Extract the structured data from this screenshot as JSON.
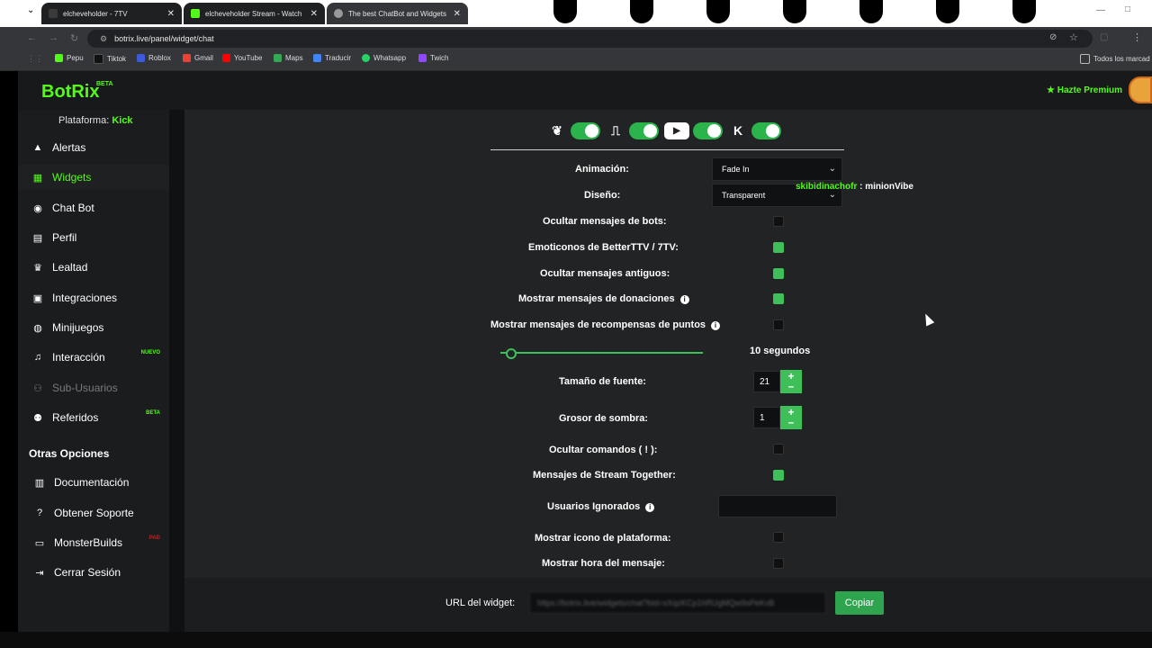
{
  "browser": {
    "tabs": [
      {
        "title": "elcheveholder - 7TV",
        "favicon_color": "#3a3a3a"
      },
      {
        "title": "elcheveholder Stream - Watch ",
        "favicon_color": "#53fc18"
      },
      {
        "title": "The best ChatBot and Widgets",
        "favicon_color": "#9a9a9a"
      }
    ],
    "url": "botrix.live/panel/widget/chat",
    "bookmarks": [
      {
        "label": "Pepu",
        "color": "#53fc18"
      },
      {
        "label": "Tiktok",
        "color": "#111111"
      },
      {
        "label": "Roblox",
        "color": "#3b5bdb"
      },
      {
        "label": "Gmail",
        "color": "#ea4335"
      },
      {
        "label": "YouTube",
        "color": "#ff0000"
      },
      {
        "label": "Maps",
        "color": "#34a853"
      },
      {
        "label": "Traducir",
        "color": "#4285f4"
      },
      {
        "label": "Whatsapp",
        "color": "#25d366"
      },
      {
        "label": "Twich",
        "color": "#9146ff"
      }
    ],
    "all_bookmarks": "Todos los marcad"
  },
  "header": {
    "logo": "BotRix",
    "beta": "BETA",
    "premium": "Hazte Premium"
  },
  "sidebar": {
    "platform_label": "Plataforma:",
    "platform_value": "Kick",
    "items": [
      {
        "label": "Alertas",
        "icon": "warning-icon"
      },
      {
        "label": "Widgets",
        "icon": "grid-icon"
      },
      {
        "label": "Chat Bot",
        "icon": "robot-icon"
      },
      {
        "label": "Perfil",
        "icon": "id-card-icon"
      },
      {
        "label": "Lealtad",
        "icon": "trophy-icon"
      },
      {
        "label": "Integraciones",
        "icon": "integrations-icon"
      },
      {
        "label": "Minijuegos",
        "icon": "gamepad-icon"
      },
      {
        "label": "Interacción",
        "icon": "music-icon",
        "tag": "NUEVO"
      },
      {
        "label": "Sub-Usuarios",
        "icon": "users-cog-icon"
      },
      {
        "label": "Referidos",
        "icon": "users-icon",
        "tag": "BETA"
      }
    ],
    "other_title": "Otras Opciones",
    "other_items": [
      {
        "label": "Documentación",
        "icon": "book-icon"
      },
      {
        "label": "Obtener Soporte",
        "icon": "question-icon"
      },
      {
        "label": "MonsterBuilds",
        "icon": "laptop-icon",
        "tag": "PAD"
      },
      {
        "label": "Cerrar Sesión",
        "icon": "logout-icon"
      }
    ]
  },
  "settings": {
    "animation_label": "Animación:",
    "animation_value": "Fade In",
    "design_label": "Diseño:",
    "design_value": "Transparent",
    "hide_bots_label": "Ocultar mensajes de bots:",
    "hide_bots": false,
    "emotes_label": "Emoticonos de BetterTTV / 7TV:",
    "emotes": true,
    "hide_old_label": "Ocultar mensajes antiguos:",
    "hide_old": true,
    "donations_label": "Mostrar mensajes de donaciones",
    "donations": true,
    "rewards_label": "Mostrar mensajes de recompensas de puntos",
    "rewards": false,
    "duration_value": "10 segundos",
    "font_size_label": "Tamaño de fuente:",
    "font_size_value": "21",
    "shadow_label": "Grosor de sombra:",
    "shadow_value": "1",
    "hide_commands_label": "Ocultar comandos ( ! ):",
    "hide_commands": false,
    "stream_together_label": "Mensajes de Stream Together:",
    "stream_together": true,
    "ignored_users_label": "Usuarios Ignorados",
    "ignored_users_value": "",
    "platform_icon_label": "Mostrar icono de plataforma:",
    "platform_icon": false,
    "message_time_label": "Mostrar hora del mensaje:",
    "message_time": false
  },
  "preview": {
    "user": "skibidinachofr",
    "separator": " : ",
    "message": "minionVibe"
  },
  "footer": {
    "url_label": "URL del widget:",
    "url_value": "https://botrix.live/widgets/chat?bid=xXqzKCp1hRUgMQw9sPeKvB",
    "copy_label": "Copiar"
  }
}
